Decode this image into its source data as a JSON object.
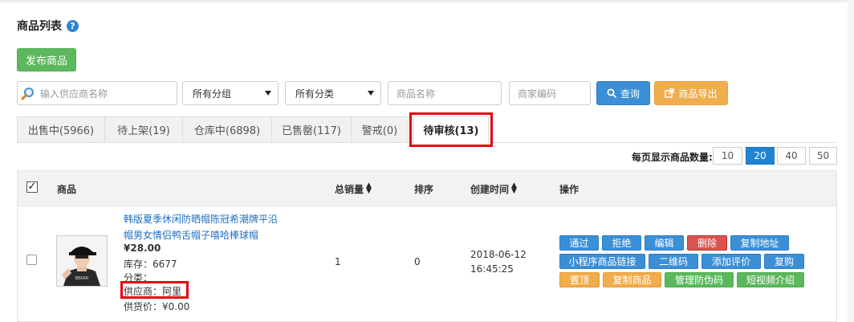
{
  "page": {
    "title": "商品列表",
    "help": "?"
  },
  "toolbar": {
    "publish_label": "发布商品"
  },
  "filters": {
    "supplier_placeholder": "输入供应商名称",
    "group_value": "所有分组",
    "category_value": "所有分类",
    "name_placeholder": "商品名称",
    "code_placeholder": "商家编码",
    "query_label": "查询",
    "export_label": "商品导出"
  },
  "tabs": [
    {
      "label": "出售中(5966)"
    },
    {
      "label": "待上架(19)"
    },
    {
      "label": "仓库中(6898)"
    },
    {
      "label": "已售罄(117)"
    },
    {
      "label": "警戒(0)"
    },
    {
      "label": "待审核(13)",
      "active": true
    }
  ],
  "per_page": {
    "label": "每页显示商品数量:",
    "options": [
      "10",
      "20",
      "40",
      "50"
    ],
    "selected": "20"
  },
  "table": {
    "columns": {
      "goods": "商品",
      "sales": "总销量",
      "sort": "排序",
      "created": "创建时间",
      "ops": "操作"
    },
    "rows": [
      {
        "title_line1": "韩版夏季休闲防晒帽陈冠希潮牌平沿",
        "title_line2": "帽男女情侣鸭舌帽子嘻哈棒球帽",
        "price": "¥28.00",
        "stock": "库存：6677",
        "category": "分类：",
        "supplier": "供应商：阿里",
        "supply_price": "供货价：¥0.00",
        "sales": "1",
        "sort": "0",
        "created_date": "2018-06-12",
        "created_time": "16:45:25",
        "thumb_text": "BEKAR"
      }
    ]
  },
  "operations": {
    "approve": "通过",
    "reject": "拒绝",
    "edit": "编辑",
    "delete": "删除",
    "copy_address": "复制地址",
    "mini_link": "小程序商品链接",
    "qrcode": "二维码",
    "add_review": "添加评价",
    "rebuy": "复购",
    "pin_top": "置顶",
    "copy_goods": "复制商品",
    "anti_fake": "管理防伪码",
    "short_video": "短视频介绍"
  },
  "colors": {
    "primary": "#3a8fd6",
    "success": "#5cb85c",
    "warning": "#f0ad4e",
    "danger": "#d9534f",
    "highlight": "#e60012",
    "link": "#1f6fbf"
  }
}
